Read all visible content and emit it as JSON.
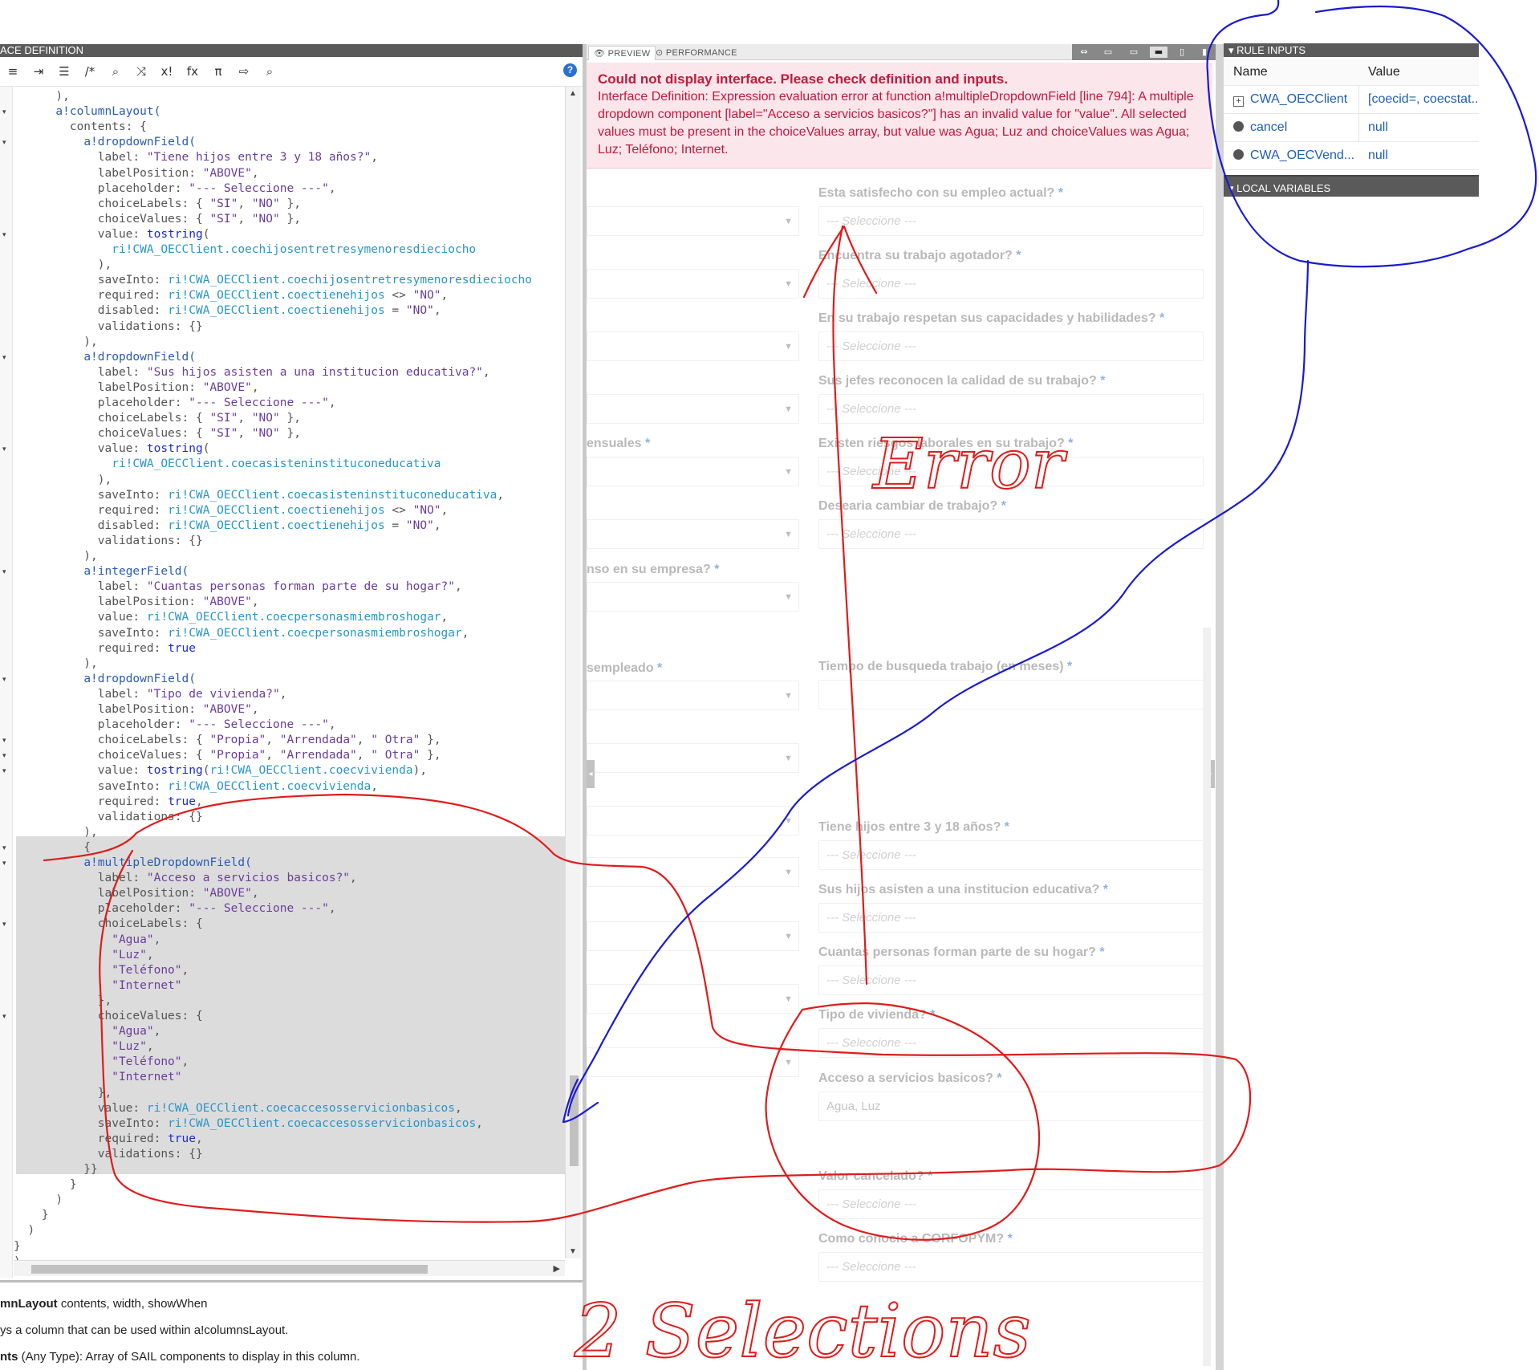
{
  "editor": {
    "title": "ACE DEFINITION",
    "help_label": "?",
    "toolbar": [
      "≡",
      "⇥",
      "☰",
      "/*",
      "⌕",
      "⤨",
      "x!",
      "fx",
      "π",
      "⇨",
      "⌕"
    ],
    "code_lines": [
      [
        [
          "p",
          "      ),"
        ]
      ],
      [
        [
          "p",
          "      "
        ],
        [
          "f",
          "a!columnLayout("
        ]
      ],
      [
        [
          "p",
          "        contents: {"
        ]
      ],
      [
        [
          "p",
          "          "
        ],
        [
          "f",
          "a!dropdownField("
        ]
      ],
      [
        [
          "p",
          "            label: "
        ],
        [
          "s",
          "\"Tiene hijos entre 3 y 18 años?\""
        ],
        [
          "p",
          ","
        ]
      ],
      [
        [
          "p",
          "            labelPosition: "
        ],
        [
          "s",
          "\"ABOVE\""
        ],
        [
          "p",
          ","
        ]
      ],
      [
        [
          "p",
          "            placeholder: "
        ],
        [
          "s",
          "\"--- Seleccione ---\""
        ],
        [
          "p",
          ","
        ]
      ],
      [
        [
          "p",
          "            choiceLabels: { "
        ],
        [
          "s",
          "\"SI\""
        ],
        [
          "p",
          ", "
        ],
        [
          "s",
          "\"NO\""
        ],
        [
          "p",
          " },"
        ]
      ],
      [
        [
          "p",
          "            choiceValues: { "
        ],
        [
          "s",
          "\"SI\""
        ],
        [
          "p",
          ", "
        ],
        [
          "s",
          "\"NO\""
        ],
        [
          "p",
          " },"
        ]
      ],
      [
        [
          "p",
          "            value: "
        ],
        [
          "k",
          "tostring"
        ],
        [
          "p",
          "("
        ]
      ],
      [
        [
          "p",
          "              "
        ],
        [
          "r",
          "ri!CWA_OECClient.coechijosentretresymenoresdieciocho"
        ]
      ],
      [
        [
          "p",
          "            ),"
        ]
      ],
      [
        [
          "p",
          "            saveInto: "
        ],
        [
          "r",
          "ri!CWA_OECClient.coechijosentretresymenoresdieciocho"
        ]
      ],
      [
        [
          "p",
          "            required: "
        ],
        [
          "r",
          "ri!CWA_OECClient.coectienehijos"
        ],
        [
          "p",
          " <> "
        ],
        [
          "s",
          "\"NO\""
        ],
        [
          "p",
          ","
        ]
      ],
      [
        [
          "p",
          "            disabled: "
        ],
        [
          "r",
          "ri!CWA_OECClient.coectienehijos"
        ],
        [
          "p",
          " = "
        ],
        [
          "s",
          "\"NO\""
        ],
        [
          "p",
          ","
        ]
      ],
      [
        [
          "p",
          "            validations: {}"
        ]
      ],
      [
        [
          "p",
          "          ),"
        ]
      ],
      [
        [
          "p",
          "          "
        ],
        [
          "f",
          "a!dropdownField("
        ]
      ],
      [
        [
          "p",
          "            label: "
        ],
        [
          "s",
          "\"Sus hijos asisten a una institucion educativa?\""
        ],
        [
          "p",
          ","
        ]
      ],
      [
        [
          "p",
          "            labelPosition: "
        ],
        [
          "s",
          "\"ABOVE\""
        ],
        [
          "p",
          ","
        ]
      ],
      [
        [
          "p",
          "            placeholder: "
        ],
        [
          "s",
          "\"--- Seleccione ---\""
        ],
        [
          "p",
          ","
        ]
      ],
      [
        [
          "p",
          "            choiceLabels: { "
        ],
        [
          "s",
          "\"SI\""
        ],
        [
          "p",
          ", "
        ],
        [
          "s",
          "\"NO\""
        ],
        [
          "p",
          " },"
        ]
      ],
      [
        [
          "p",
          "            choiceValues: { "
        ],
        [
          "s",
          "\"SI\""
        ],
        [
          "p",
          ", "
        ],
        [
          "s",
          "\"NO\""
        ],
        [
          "p",
          " },"
        ]
      ],
      [
        [
          "p",
          "            value: "
        ],
        [
          "k",
          "tostring"
        ],
        [
          "p",
          "("
        ]
      ],
      [
        [
          "p",
          "              "
        ],
        [
          "r",
          "ri!CWA_OECClient.coecasisteninstituconeducativa"
        ]
      ],
      [
        [
          "p",
          "            ),"
        ]
      ],
      [
        [
          "p",
          "            saveInto: "
        ],
        [
          "r",
          "ri!CWA_OECClient.coecasisteninstituconeducativa"
        ],
        [
          "p",
          ","
        ]
      ],
      [
        [
          "p",
          "            required: "
        ],
        [
          "r",
          "ri!CWA_OECClient.coectienehijos"
        ],
        [
          "p",
          " <> "
        ],
        [
          "s",
          "\"NO\""
        ],
        [
          "p",
          ","
        ]
      ],
      [
        [
          "p",
          "            disabled: "
        ],
        [
          "r",
          "ri!CWA_OECClient.coectienehijos"
        ],
        [
          "p",
          " = "
        ],
        [
          "s",
          "\"NO\""
        ],
        [
          "p",
          ","
        ]
      ],
      [
        [
          "p",
          "            validations: {}"
        ]
      ],
      [
        [
          "p",
          "          ),"
        ]
      ],
      [
        [
          "p",
          "          "
        ],
        [
          "f",
          "a!integerField("
        ]
      ],
      [
        [
          "p",
          "            label: "
        ],
        [
          "s",
          "\"Cuantas personas forman parte de su hogar?\""
        ],
        [
          "p",
          ","
        ]
      ],
      [
        [
          "p",
          "            labelPosition: "
        ],
        [
          "s",
          "\"ABOVE\""
        ],
        [
          "p",
          ","
        ]
      ],
      [
        [
          "p",
          "            value: "
        ],
        [
          "r",
          "ri!CWA_OECClient.coecpersonasmiembroshogar"
        ],
        [
          "p",
          ","
        ]
      ],
      [
        [
          "p",
          "            saveInto: "
        ],
        [
          "r",
          "ri!CWA_OECClient.coecpersonasmiembroshogar"
        ],
        [
          "p",
          ","
        ]
      ],
      [
        [
          "p",
          "            required: "
        ],
        [
          "k",
          "true"
        ]
      ],
      [
        [
          "p",
          "          ),"
        ]
      ],
      [
        [
          "p",
          "          "
        ],
        [
          "f",
          "a!dropdownField("
        ]
      ],
      [
        [
          "p",
          "            label: "
        ],
        [
          "s",
          "\"Tipo de vivienda?\""
        ],
        [
          "p",
          ","
        ]
      ],
      [
        [
          "p",
          "            labelPosition: "
        ],
        [
          "s",
          "\"ABOVE\""
        ],
        [
          "p",
          ","
        ]
      ],
      [
        [
          "p",
          "            placeholder: "
        ],
        [
          "s",
          "\"--- Seleccione ---\""
        ],
        [
          "p",
          ","
        ]
      ],
      [
        [
          "p",
          "            choiceLabels: { "
        ],
        [
          "s",
          "\"Propia\""
        ],
        [
          "p",
          ", "
        ],
        [
          "s",
          "\"Arrendada\""
        ],
        [
          "p",
          ", "
        ],
        [
          "s",
          "\" Otra\""
        ],
        [
          "p",
          " },"
        ]
      ],
      [
        [
          "p",
          "            choiceValues: { "
        ],
        [
          "s",
          "\"Propia\""
        ],
        [
          "p",
          ", "
        ],
        [
          "s",
          "\"Arrendada\""
        ],
        [
          "p",
          ", "
        ],
        [
          "s",
          "\" Otra\""
        ],
        [
          "p",
          " },"
        ]
      ],
      [
        [
          "p",
          "            value: "
        ],
        [
          "k",
          "tostring"
        ],
        [
          "p",
          "("
        ],
        [
          "r",
          "ri!CWA_OECClient.coecvivienda"
        ],
        [
          "p",
          "),"
        ]
      ],
      [
        [
          "p",
          "            saveInto: "
        ],
        [
          "r",
          "ri!CWA_OECClient.coecvivienda"
        ],
        [
          "p",
          ","
        ]
      ],
      [
        [
          "p",
          "            required: "
        ],
        [
          "k",
          "true"
        ],
        [
          "p",
          ","
        ]
      ],
      [
        [
          "p",
          "            validations: {}"
        ]
      ],
      [
        [
          "p",
          "          ),"
        ]
      ],
      [
        [
          "p",
          "          {"
        ]
      ],
      [
        [
          "p",
          "          "
        ],
        [
          "f",
          "a!multipleDropdownField("
        ]
      ],
      [
        [
          "p",
          "            label: "
        ],
        [
          "s",
          "\"Acceso a servicios basicos?\""
        ],
        [
          "p",
          ","
        ]
      ],
      [
        [
          "p",
          "            labelPosition: "
        ],
        [
          "s",
          "\"ABOVE\""
        ],
        [
          "p",
          ","
        ]
      ],
      [
        [
          "p",
          "            placeholder: "
        ],
        [
          "s",
          "\"--- Seleccione ---\""
        ],
        [
          "p",
          ","
        ]
      ],
      [
        [
          "p",
          "            choiceLabels: {"
        ]
      ],
      [
        [
          "p",
          "              "
        ],
        [
          "s",
          "\"Agua\""
        ],
        [
          "p",
          ","
        ]
      ],
      [
        [
          "p",
          "              "
        ],
        [
          "s",
          "\"Luz\""
        ],
        [
          "p",
          ","
        ]
      ],
      [
        [
          "p",
          "              "
        ],
        [
          "s",
          "\"Teléfono\""
        ],
        [
          "p",
          ","
        ]
      ],
      [
        [
          "p",
          "              "
        ],
        [
          "s",
          "\"Internet\""
        ]
      ],
      [
        [
          "p",
          "            },"
        ]
      ],
      [
        [
          "p",
          "            choiceValues: {"
        ]
      ],
      [
        [
          "p",
          "              "
        ],
        [
          "s",
          "\"Agua\""
        ],
        [
          "p",
          ","
        ]
      ],
      [
        [
          "p",
          "              "
        ],
        [
          "s",
          "\"Luz\""
        ],
        [
          "p",
          ","
        ]
      ],
      [
        [
          "p",
          "              "
        ],
        [
          "s",
          "\"Teléfono\""
        ],
        [
          "p",
          ","
        ]
      ],
      [
        [
          "p",
          "              "
        ],
        [
          "s",
          "\"Internet\""
        ]
      ],
      [
        [
          "p",
          "            },"
        ]
      ],
      [
        [
          "p",
          "            value: "
        ],
        [
          "r",
          "ri!CWA_OECClient.coecaccesosservicionbasicos"
        ],
        [
          "p",
          ","
        ]
      ],
      [
        [
          "p",
          "            saveInto: "
        ],
        [
          "r",
          "ri!CWA_OECClient.coecaccesosservicionbasicos"
        ],
        [
          "p",
          ","
        ]
      ],
      [
        [
          "p",
          "            required: "
        ],
        [
          "k",
          "true"
        ],
        [
          "p",
          ","
        ]
      ],
      [
        [
          "p",
          "            validations: {}"
        ]
      ],
      [
        [
          "p",
          "          }}"
        ]
      ],
      [
        [
          "p",
          "        }"
        ]
      ],
      [
        [
          "p",
          "      )"
        ]
      ],
      [
        [
          "p",
          "    }"
        ]
      ],
      [
        [
          "p",
          "  )"
        ]
      ],
      [
        [
          "p",
          "}"
        ]
      ],
      [
        [
          "p",
          ")"
        ]
      ]
    ],
    "doc": {
      "line1_bold": "mnLayout",
      "line1_rest": "  contents, width, showWhen",
      "line2": "ys a column that can be used within a!columnsLayout.",
      "line3_bold": "nts",
      "line3_rest": " (Any Type): Array of SAIL components to display in this column."
    }
  },
  "preview": {
    "tabs": {
      "preview": "PREVIEW",
      "performance": "PERFORMANCE"
    },
    "error": {
      "title": "Could not display interface. Please check definition and inputs.",
      "body": "Interface Definition: Expression evaluation error at function a!multipleDropdownField [line 794]: A multiple dropdown component [label=\"Acceso a servicios basicos?\"] has an invalid value for \"value\". All selected values must be present in the choiceValues array, but value was Agua; Luz and choiceValues was Agua; Luz; Teléfono; Internet."
    },
    "placeholder": "--- Seleccione ---",
    "right_fields": [
      "Esta satisfecho con su empleo actual?",
      "Encuentra su trabajo agotador?",
      "En su trabajo respetan sus capacidades y habilidades?",
      "Sus jefes reconocen la calidad de su trabajo?",
      "Existen riesgos laborales en su trabajo?",
      "Desearia cambiar de trabajo?",
      "Tiempo de busqueda trabajo (en meses)",
      "Tiene hijos entre 3 y 18 años?",
      "Sus hijos asisten a una institucion educativa?",
      "Cuantas personas forman parte de su hogar?",
      "Tipo de vivienda?",
      "Acceso a servicios basicos?",
      "Valor cancelado?",
      "Como conocio a CORFOPYM?"
    ],
    "left_fields": [
      "ensuales",
      "nso en su empresa?",
      "sempleado"
    ],
    "selected_value": "Agua, Luz",
    "required_mark": "*"
  },
  "rule_inputs": {
    "title": "RULE INPUTS",
    "col_name": "Name",
    "col_value": "Value",
    "rows": [
      {
        "name": "CWA_OECClient",
        "value": "[coecid=, coecstat..."
      },
      {
        "name": "cancel",
        "value": "null"
      },
      {
        "name": "CWA_OECVend...",
        "value": "null"
      }
    ],
    "local_variables": "LOCAL VARIABLES"
  },
  "annotations": {
    "error_label": "Error",
    "selections_label": "2 Selections",
    "red_color": "#e01b1b",
    "blue_color": "#1a1ad0"
  }
}
